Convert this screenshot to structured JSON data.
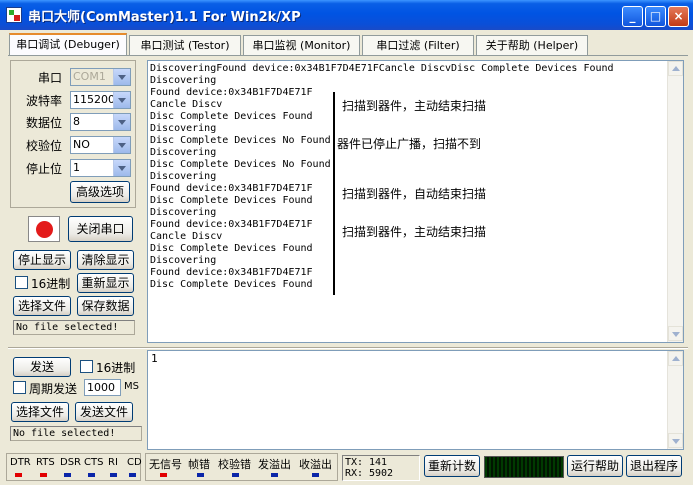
{
  "window": {
    "title": "串口大师(ComMaster)1.1 For Win2k/XP",
    "controls": {
      "minimize": "_",
      "maximize": "□",
      "close": "×"
    }
  },
  "tabs": [
    {
      "label": "串口调试 (Debuger)",
      "active": true
    },
    {
      "label": "串口测试 (Testor)",
      "active": false
    },
    {
      "label": "串口监视 (Monitor)",
      "active": false
    },
    {
      "label": "串口过滤 (Filter)",
      "active": false
    },
    {
      "label": "关于帮助 (Helper)",
      "active": false
    }
  ],
  "settings": {
    "port": {
      "label": "串口",
      "value": "COM1",
      "disabled": true
    },
    "baud": {
      "label": "波特率",
      "value": "115200"
    },
    "databits": {
      "label": "数据位",
      "value": "8"
    },
    "parity": {
      "label": "校验位",
      "value": "NO"
    },
    "stopbits": {
      "label": "停止位",
      "value": "1"
    },
    "advanced_button": "高级选项"
  },
  "port_control": {
    "close_port_button": "关闭串口",
    "indicator_color": "#E31B1B"
  },
  "receive_panel": {
    "stop_display_button": "停止显示",
    "clear_display_button": "清除显示",
    "hex_label": "16进制",
    "hex_checked": false,
    "redisplay_button": "重新显示",
    "select_file_button": "选择文件",
    "save_data_button": "保存数据",
    "file_status": "No file selected!"
  },
  "receive_log": [
    "DiscoveringFound device:0x34B1F7D4E71FCancle DiscvDisc Complete Devices Found",
    "Discovering",
    "Found device:0x34B1F7D4E71F",
    "Cancle Discv",
    "Disc Complete Devices Found",
    "Discovering",
    "Disc Complete Devices No Found",
    "Discovering",
    "Disc Complete Devices No Found",
    "Discovering",
    "Found device:0x34B1F7D4E71F",
    "Disc Complete Devices Found",
    "Discovering",
    "Found device:0x34B1F7D4E71F",
    "Cancle Discv",
    "Disc Complete Devices Found",
    "Discovering",
    "Found device:0x34B1F7D4E71F",
    "Disc Complete Devices Found"
  ],
  "annotations": [
    "扫描到器件，主动结束扫描",
    "器件已停止广播，扫描不到",
    "扫描到器件，自动结束扫描",
    "扫描到器件，主动结束扫描"
  ],
  "send_panel": {
    "send_button": "发送",
    "hex_label": "16进制",
    "hex_checked": false,
    "periodic_label": "周期发送",
    "periodic_checked": false,
    "period_value": "1000",
    "period_unit": "MS",
    "select_file_button": "选择文件",
    "send_file_button": "发送文件",
    "file_status": "No file selected!",
    "send_text": "1"
  },
  "status_bar": {
    "signals": [
      "DTR",
      "RTS",
      "DSR",
      "CTS",
      "RI",
      "CD"
    ],
    "signal_led_colors": [
      "#E20000",
      "#E20000",
      "#0A25A8",
      "#0A25A8",
      "#0A25A8",
      "#0A25A8"
    ],
    "errors": [
      "无信号",
      "帧错",
      "校验错",
      "发溢出",
      "收溢出"
    ],
    "error_led_colors": [
      "#E20000",
      "#0A25A8",
      "#0A25A8",
      "#0A25A8",
      "#0A25A8"
    ],
    "tx_label": "TX:",
    "tx_value": "141",
    "rx_label": "RX:",
    "rx_value": "5902",
    "recount_button": "重新计数",
    "help_button": "运行帮助",
    "exit_button": "退出程序"
  }
}
